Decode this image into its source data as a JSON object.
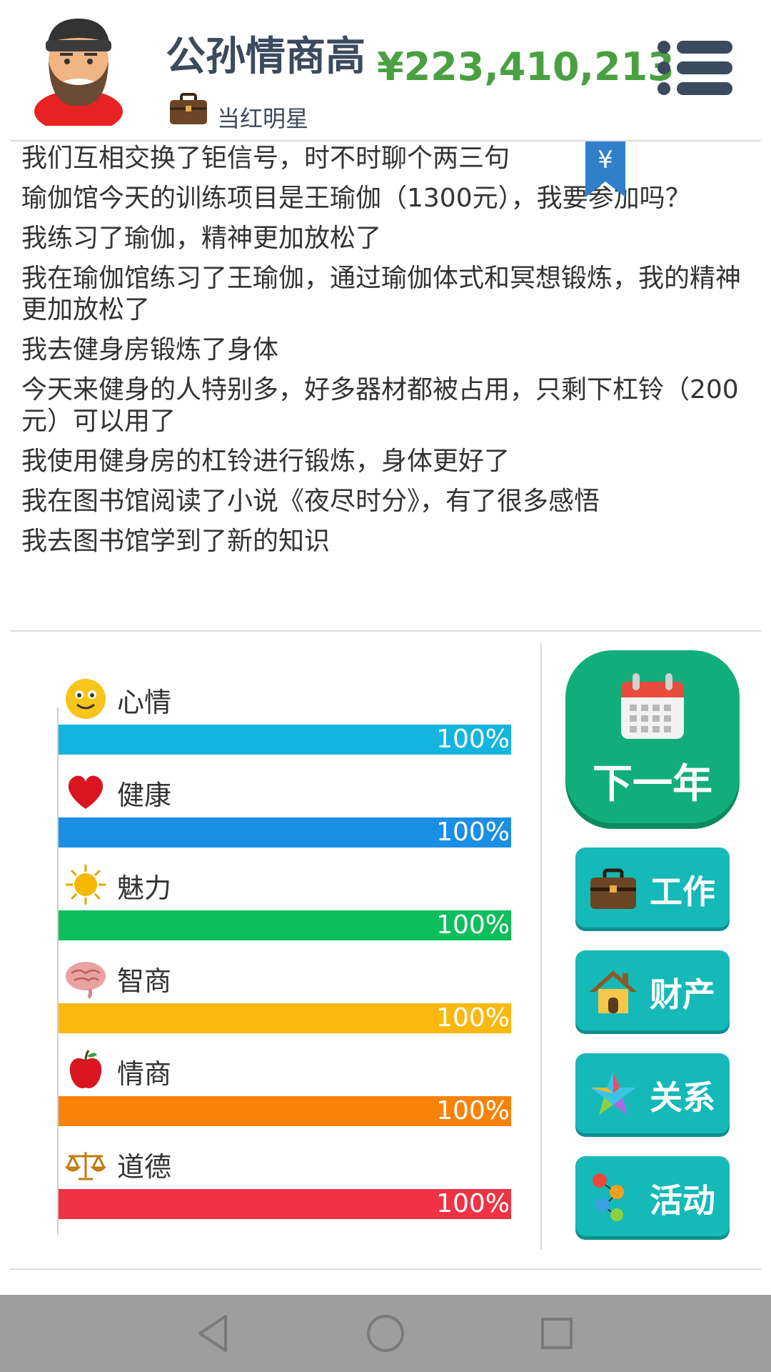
{
  "header": {
    "player_name": "公孙情商高",
    "money": "¥223,410,213",
    "job_title": "当红明星",
    "menu_icon": "hamburger-menu-icon",
    "avatar_icon": "bearded-man-avatar"
  },
  "log": {
    "bookmark_symbol": "¥",
    "lines": [
      "我们互相交换了钜信号，时不时聊个两三句",
      "瑜伽馆今天的训练项目是王瑜伽（1300元），我要参加吗？",
      "我练习了瑜伽，精神更加放松了",
      "我在瑜伽馆练习了王瑜伽，通过瑜伽体式和冥想锻炼，我的精神更加放松了",
      "我去健身房锻炼了身体",
      "今天来健身的人特别多，好多器材都被占用，只剩下杠铃（200元）可以用了",
      "我使用健身房的杠铃进行锻炼，身体更好了",
      "我在图书馆阅读了小说《夜尽时分》，有了很多感悟",
      "我去图书馆学到了新的知识"
    ]
  },
  "stats": [
    {
      "label": "心情",
      "value": 100,
      "pct_text": "100%",
      "color": "#13b5de",
      "icon": "smiley-face-icon"
    },
    {
      "label": "健康",
      "value": 100,
      "pct_text": "100%",
      "color": "#1a8fe3",
      "icon": "heart-icon"
    },
    {
      "label": "魅力",
      "value": 100,
      "pct_text": "100%",
      "color": "#0cbf5c",
      "icon": "sun-icon"
    },
    {
      "label": "智商",
      "value": 100,
      "pct_text": "100%",
      "color": "#fbb80f",
      "icon": "brain-icon"
    },
    {
      "label": "情商",
      "value": 100,
      "pct_text": "100%",
      "color": "#fa8209",
      "icon": "apple-icon"
    },
    {
      "label": "道德",
      "value": 100,
      "pct_text": "100%",
      "color": "#ef3345",
      "icon": "scales-icon"
    }
  ],
  "actions": {
    "next_year": {
      "label": "下一年",
      "icon": "calendar-icon"
    },
    "buttons": [
      {
        "label": "工作",
        "icon": "briefcase-icon"
      },
      {
        "label": "财产",
        "icon": "house-icon"
      },
      {
        "label": "关系",
        "icon": "star-icon"
      },
      {
        "label": "活动",
        "icon": "activity-dots-icon"
      }
    ]
  },
  "navbar": {
    "back_icon": "back-triangle-icon",
    "home_icon": "home-circle-icon",
    "recents_icon": "recents-square-icon"
  },
  "colors": {
    "money": "#4aa040",
    "name": "#3b4a5c",
    "next_year_button": "#11ae7c",
    "side_buttons": "#15b9b8"
  }
}
